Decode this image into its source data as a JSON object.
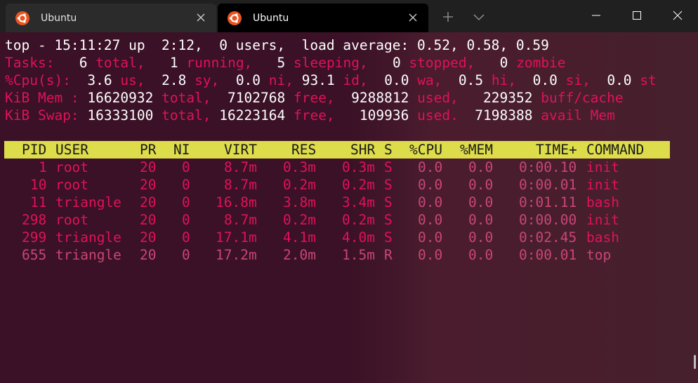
{
  "tabs": [
    {
      "title": "Ubuntu",
      "icon": "ubuntu-logo-icon",
      "active": false
    },
    {
      "title": "Ubuntu",
      "icon": "ubuntu-logo-icon",
      "active": true
    }
  ],
  "colors": {
    "accent": "#e95420",
    "header_bar": "#dddc4b",
    "label_pink": "#e0125a",
    "row_pink": "#c94676"
  },
  "top": {
    "line1": "top - 15:11:27 up  2:12,  0 users,  load average: 0.52, 0.58, 0.59",
    "tasks": {
      "label": "Tasks:",
      "total": "6",
      "total_l": "total,",
      "running": "1",
      "running_l": "running,",
      "sleeping": "5",
      "sleeping_l": "sleeping,",
      "stopped": "0",
      "stopped_l": "stopped,",
      "zombie": "0",
      "zombie_l": "zombie"
    },
    "cpu": {
      "label": "%Cpu(s):",
      "us": "3.6",
      "us_l": "us,",
      "sy": "2.8",
      "sy_l": "sy,",
      "ni": "0.0",
      "ni_l": "ni,",
      "id": "93.1",
      "id_l": "id,",
      "wa": "0.0",
      "wa_l": "wa,",
      "hi": "0.5",
      "hi_l": "hi,",
      "si": "0.0",
      "si_l": "si,",
      "st": "0.0",
      "st_l": "st"
    },
    "mem": {
      "label": "KiB Mem :",
      "total": "16620932",
      "total_l": "total,",
      "free": "7102768",
      "free_l": "free,",
      "used": "9288812",
      "used_l": "used,",
      "buff": "229352",
      "buff_l": "buff/cache"
    },
    "swap": {
      "label": "KiB Swap:",
      "total": "16333100",
      "total_l": "total,",
      "free": "16223164",
      "free_l": "free,",
      "used": "109936",
      "used_l": "used.",
      "avail": "7198388",
      "avail_l": "avail Mem"
    },
    "columns": [
      "PID",
      "USER",
      "PR",
      "NI",
      "VIRT",
      "RES",
      "SHR",
      "S",
      "%CPU",
      "%MEM",
      "TIME+",
      "COMMAND"
    ],
    "processes": [
      {
        "pid": "1",
        "user": "root",
        "pr": "20",
        "ni": "0",
        "virt": "8.7m",
        "res": "0.3m",
        "shr": "0.3m",
        "s": "S",
        "cpu": "0.0",
        "mem": "0.0",
        "time": "0:00.10",
        "cmd": "init"
      },
      {
        "pid": "10",
        "user": "root",
        "pr": "20",
        "ni": "0",
        "virt": "8.7m",
        "res": "0.2m",
        "shr": "0.2m",
        "s": "S",
        "cpu": "0.0",
        "mem": "0.0",
        "time": "0:00.01",
        "cmd": "init"
      },
      {
        "pid": "11",
        "user": "triangle",
        "pr": "20",
        "ni": "0",
        "virt": "16.8m",
        "res": "3.8m",
        "shr": "3.4m",
        "s": "S",
        "cpu": "0.0",
        "mem": "0.0",
        "time": "0:01.11",
        "cmd": "bash"
      },
      {
        "pid": "298",
        "user": "root",
        "pr": "20",
        "ni": "0",
        "virt": "8.7m",
        "res": "0.2m",
        "shr": "0.2m",
        "s": "S",
        "cpu": "0.0",
        "mem": "0.0",
        "time": "0:00.00",
        "cmd": "init"
      },
      {
        "pid": "299",
        "user": "triangle",
        "pr": "20",
        "ni": "0",
        "virt": "17.1m",
        "res": "4.1m",
        "shr": "4.0m",
        "s": "S",
        "cpu": "0.0",
        "mem": "0.0",
        "time": "0:02.45",
        "cmd": "bash"
      },
      {
        "pid": "655",
        "user": "triangle",
        "pr": "20",
        "ni": "0",
        "virt": "17.2m",
        "res": "2.0m",
        "shr": "1.5m",
        "s": "R",
        "cpu": "0.0",
        "mem": "0.0",
        "time": "0:00.01",
        "cmd": "top"
      }
    ]
  }
}
